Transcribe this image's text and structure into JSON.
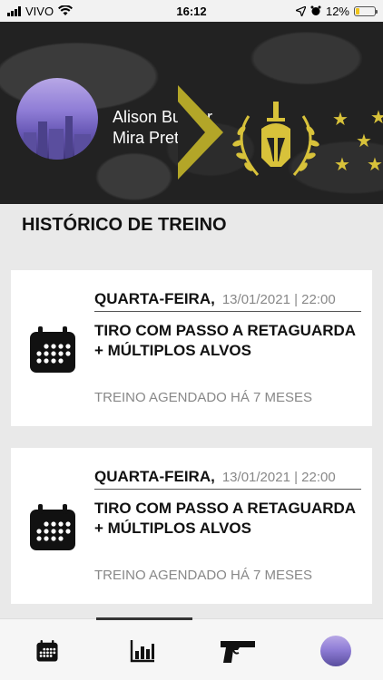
{
  "status_bar": {
    "carrier": "VIVO",
    "time": "16:12",
    "battery": "12%"
  },
  "profile": {
    "name_line1": "Alison Bucker",
    "name_line2": "Mira Preta"
  },
  "section": {
    "title": "HISTÓRICO DE TREINO"
  },
  "trainings": [
    {
      "day": "QUARTA-FEIRA,",
      "date": "13/01/2021 | 22:00",
      "title": "TIRO COM PASSO A RETAGUARDA + MÚLTIPLOS ALVOS",
      "status": "TREINO AGENDADO HÁ 7 MESES"
    },
    {
      "day": "QUARTA-FEIRA,",
      "date": "13/01/2021 | 22:00",
      "title": "TIRO COM PASSO A RETAGUARDA + MÚLTIPLOS ALVOS",
      "status": "TREINO AGENDADO HÁ 7 MESES"
    }
  ],
  "tabbar": {
    "tabs": [
      {
        "icon": "calendar-icon"
      },
      {
        "icon": "bar-chart-icon"
      },
      {
        "icon": "pistol-icon"
      },
      {
        "icon": "avatar"
      }
    ],
    "active_index": 1
  },
  "colors": {
    "accent": "#b3a628",
    "gold": "#d8c23a",
    "banner_bg": "#222222"
  }
}
